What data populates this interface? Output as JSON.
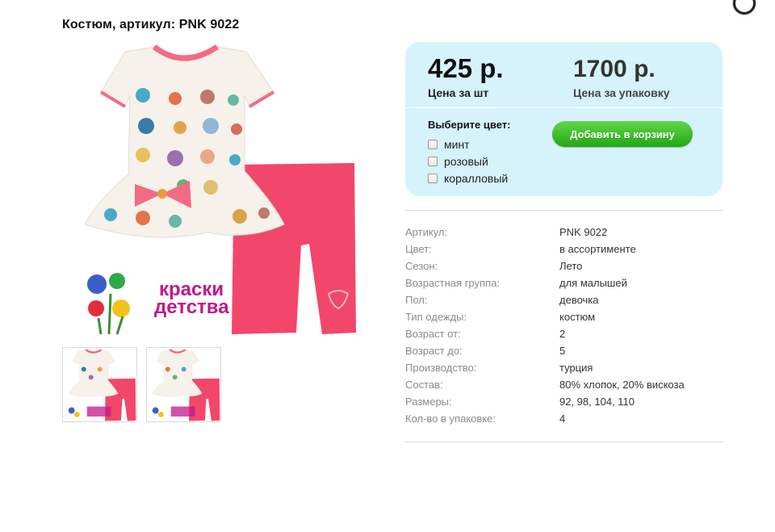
{
  "page": {
    "title": "Костюм, артикул: PNK 9022"
  },
  "gallery": {
    "brand_logo_text": [
      "краски",
      "детства"
    ],
    "thumbnails": [
      "thumb-1",
      "thumb-2"
    ]
  },
  "pricing": {
    "unit_price": "425 р.",
    "unit_caption": "Цена за шт",
    "pack_price": "1700 р.",
    "pack_caption": "Цена за упаковку"
  },
  "color_select": {
    "label": "Выберите цвет:",
    "options": [
      {
        "label": "минт",
        "checked": false
      },
      {
        "label": "розовый",
        "checked": false
      },
      {
        "label": "коралловый",
        "checked": false
      }
    ]
  },
  "cart": {
    "button_label": "Добавить в корзину"
  },
  "specs": [
    {
      "key": "Артикул:",
      "value": "PNK 9022"
    },
    {
      "key": "Цвет:",
      "value": "в ассортименте"
    },
    {
      "key": "Сезон:",
      "value": "Лето"
    },
    {
      "key": "Возрастная группа:",
      "value": "для малышей"
    },
    {
      "key": "Пол:",
      "value": "девочка"
    },
    {
      "key": "Тип одежды:",
      "value": "костюм"
    },
    {
      "key": "Возраст от:",
      "value": "2"
    },
    {
      "key": "Возраст до:",
      "value": "5"
    },
    {
      "key": "Производство:",
      "value": "турция"
    },
    {
      "key": "Состав:",
      "value": "80% хлопок, 20% вискоза"
    },
    {
      "key": "Размеры:",
      "value": "92, 98, 104, 110"
    },
    {
      "key": "Кол-во в упаковке:",
      "value": "4"
    }
  ],
  "colors": {
    "panel_bg": "#d6f2fb",
    "cart_green": "#2eb51e",
    "leggings_pink": "#f2476a",
    "brand_magenta": "#c2188a"
  }
}
